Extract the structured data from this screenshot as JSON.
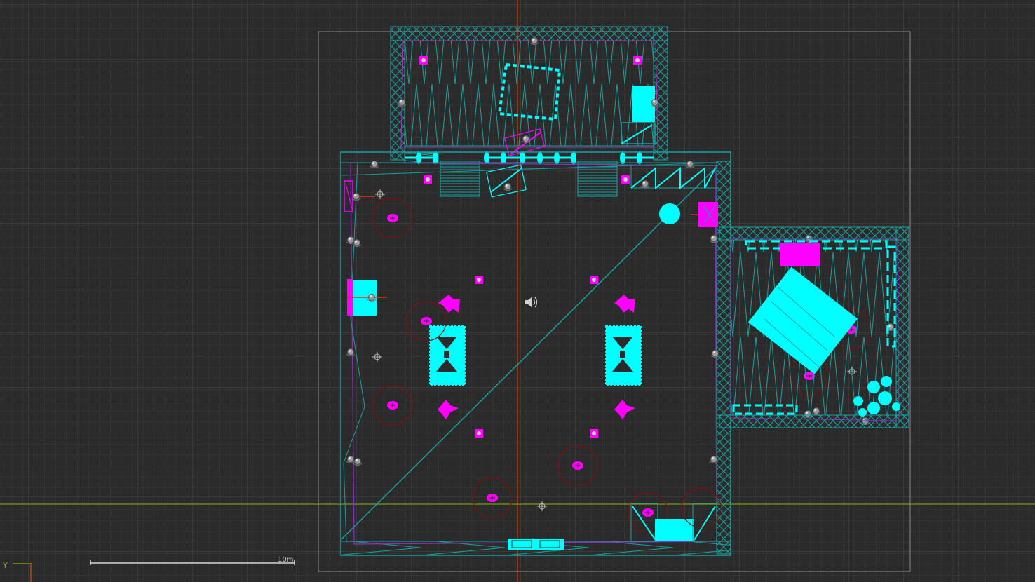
{
  "viewport": {
    "view": "top",
    "grid": true,
    "scale_label": "10m",
    "axis_label": "Y"
  },
  "colors": {
    "background": "#2b2b2b",
    "grid_minor": "#3a3a3a",
    "grid_major": "#454545",
    "wireframe": "#19a0a0",
    "mesh_selected": "#00ffff",
    "entity": "#ff00ff",
    "helper_circle": "#8b1010",
    "axis_x": "#d04010",
    "axis_y": "#7a9a10",
    "bounds": "#8a8a8a",
    "icon": "#b8b8b8"
  }
}
